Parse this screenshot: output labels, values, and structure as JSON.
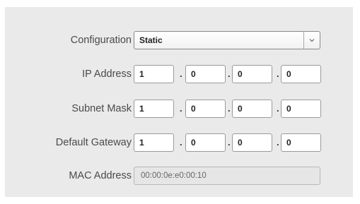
{
  "configuration": {
    "label": "Configuration",
    "value": "Static",
    "dropdown_icon": "chevron-down-icon"
  },
  "ip_address": {
    "label": "IP Address",
    "octets": [
      "1",
      "0",
      "0",
      "0"
    ],
    "separator": "."
  },
  "subnet_mask": {
    "label": "Subnet Mask",
    "octets": [
      "1",
      "0",
      "0",
      "0"
    ],
    "separator": "."
  },
  "default_gateway": {
    "label": "Default Gateway",
    "octets": [
      "1",
      "0",
      "0",
      "0"
    ],
    "separator": "."
  },
  "mac_address": {
    "label": "MAC Address",
    "value": "00:00:0e:e0:00:10"
  }
}
